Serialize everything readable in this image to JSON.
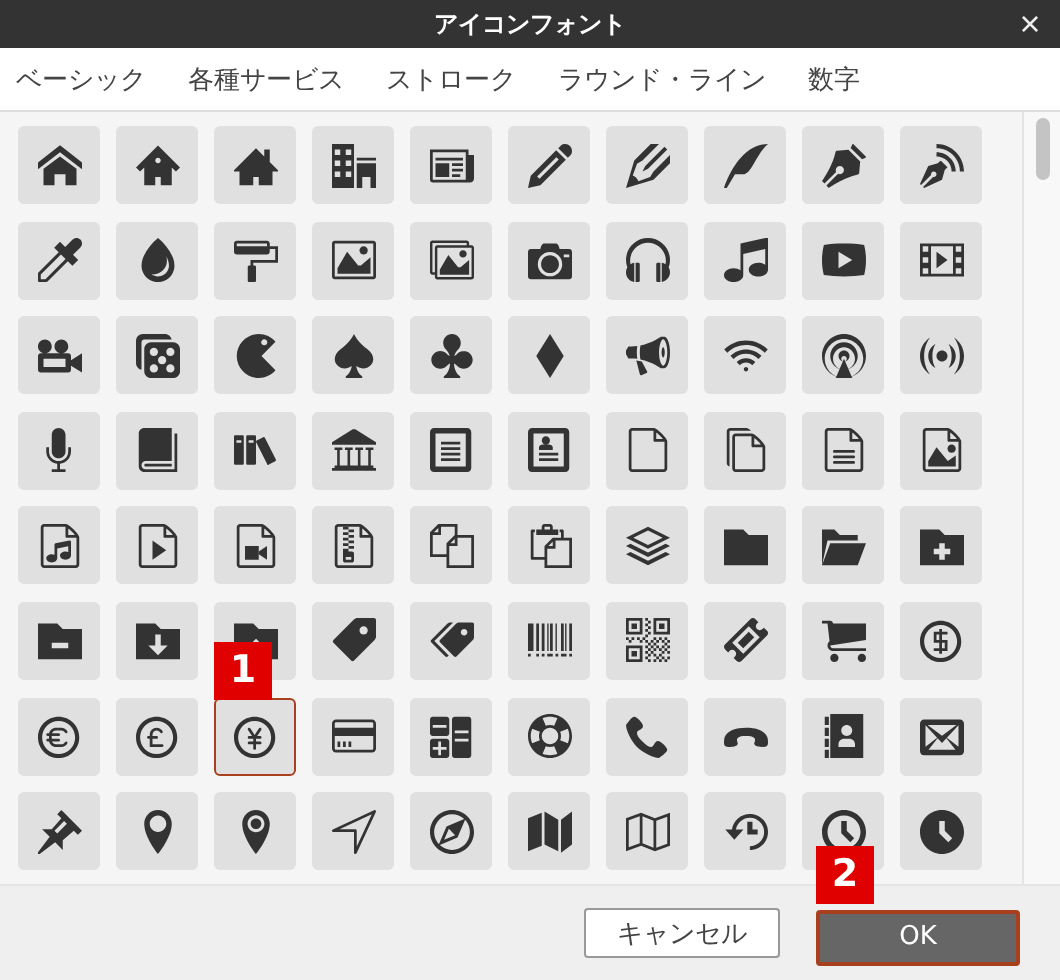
{
  "window": {
    "title": "アイコンフォント",
    "close": "×"
  },
  "tabs": [
    "ベーシック",
    "各種サービス",
    "ストローク",
    "ラウンド・ライン",
    "数字"
  ],
  "icons": [
    {
      "selected": false
    },
    {
      "selected": false
    },
    {
      "selected": false
    },
    {
      "selected": false
    },
    {
      "selected": false
    },
    {
      "selected": false
    },
    {
      "selected": false
    },
    {
      "selected": false
    },
    {
      "selected": false
    },
    {
      "selected": false
    },
    {
      "selected": false
    },
    {
      "selected": false
    },
    {
      "selected": false
    },
    {
      "selected": false
    },
    {
      "selected": false
    },
    {
      "selected": false
    },
    {
      "selected": false
    },
    {
      "selected": false
    },
    {
      "selected": false
    },
    {
      "selected": false
    },
    {
      "selected": false
    },
    {
      "selected": false
    },
    {
      "selected": false
    },
    {
      "selected": false
    },
    {
      "selected": false
    },
    {
      "selected": false
    },
    {
      "selected": false
    },
    {
      "selected": false
    },
    {
      "selected": false
    },
    {
      "selected": false
    },
    {
      "selected": false
    },
    {
      "selected": false
    },
    {
      "selected": false
    },
    {
      "selected": false
    },
    {
      "selected": false
    },
    {
      "selected": false
    },
    {
      "selected": false
    },
    {
      "selected": false
    },
    {
      "selected": false
    },
    {
      "selected": false
    },
    {
      "selected": false
    },
    {
      "selected": false
    },
    {
      "selected": false
    },
    {
      "selected": false
    },
    {
      "selected": false
    },
    {
      "selected": false
    },
    {
      "selected": false
    },
    {
      "selected": false
    },
    {
      "selected": false
    },
    {
      "selected": false
    },
    {
      "selected": false
    },
    {
      "selected": false
    },
    {
      "selected": false
    },
    {
      "selected": false
    },
    {
      "selected": false
    },
    {
      "selected": false
    },
    {
      "selected": false
    },
    {
      "selected": false
    },
    {
      "selected": false
    },
    {
      "selected": false
    },
    {
      "selected": false
    },
    {
      "selected": false
    },
    {
      "selected": true,
      "marker": "1"
    },
    {
      "selected": false
    },
    {
      "selected": false
    },
    {
      "selected": false
    },
    {
      "selected": false
    },
    {
      "selected": false
    },
    {
      "selected": false
    },
    {
      "selected": false
    },
    {
      "selected": false
    },
    {
      "selected": false
    },
    {
      "selected": false
    },
    {
      "selected": false
    },
    {
      "selected": false
    },
    {
      "selected": false
    },
    {
      "selected": false
    },
    {
      "selected": false
    },
    {
      "selected": false
    },
    {
      "selected": false
    }
  ],
  "buttons": [
    {
      "label": "キャンセル",
      "kind": "default"
    },
    {
      "label": "OK",
      "kind": "primary",
      "marker": "2"
    }
  ]
}
